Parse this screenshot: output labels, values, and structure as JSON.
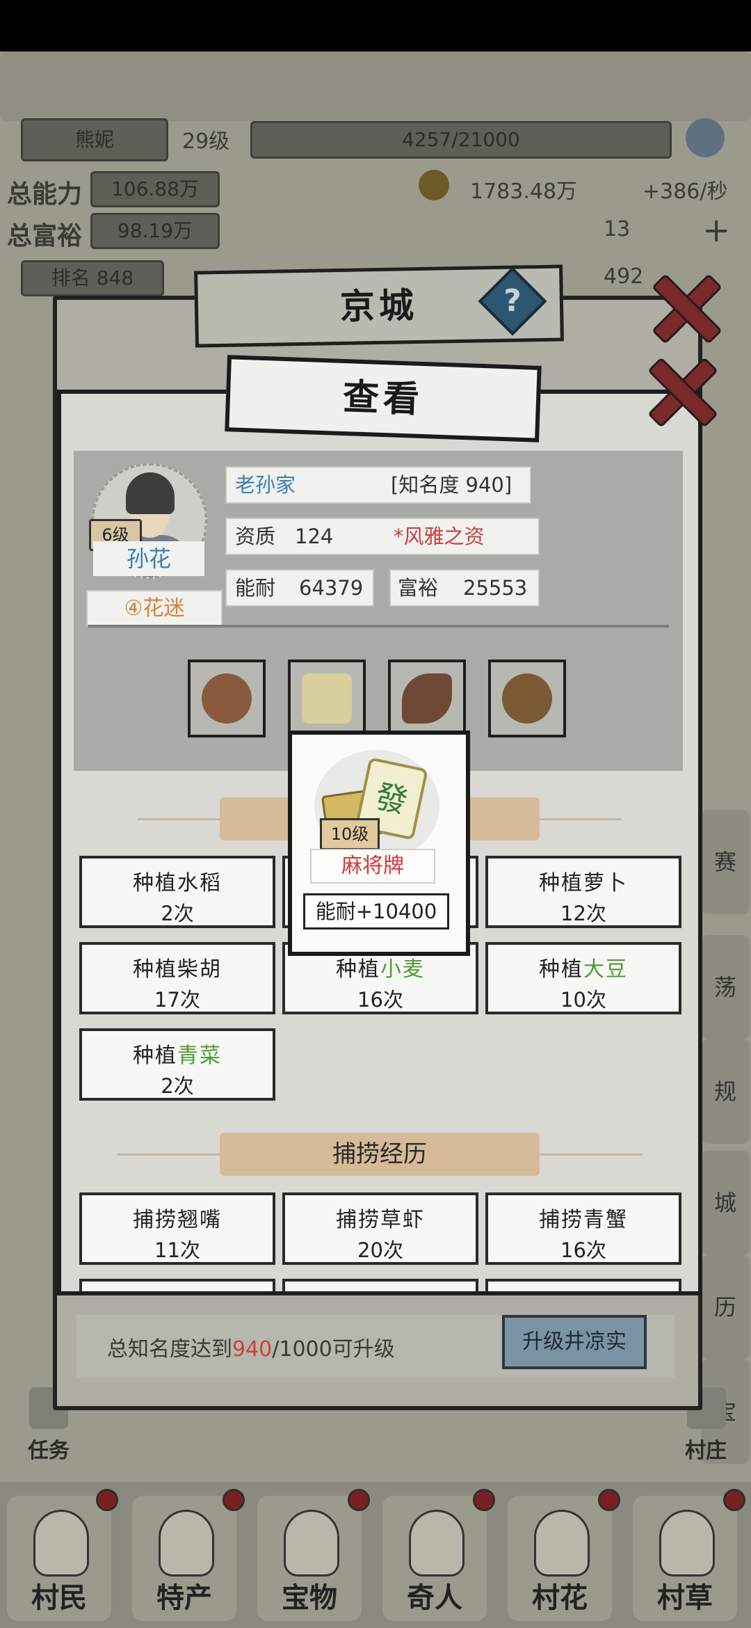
{
  "background": {
    "player_name": "熊妮",
    "player_level": "29级",
    "exp_progress": "4257/21000",
    "left_label_1": "总能力",
    "left_value_1": "106.88万",
    "left_label_2": "总富裕",
    "left_value_2": "98.19万",
    "coins": "1783.48万",
    "coin_rate": "+386/秒",
    "count": "13",
    "rank": "排名 848",
    "num_492": "492",
    "task_label": "任务",
    "village_label": "村庄",
    "side_tabs": [
      "赛",
      "荡",
      "规",
      "城",
      "历",
      "宝"
    ]
  },
  "back_panel": {
    "title": "京城",
    "help": "?",
    "footer_prefix": "总知名度达到",
    "footer_current": "940",
    "footer_suffix": "/1000可升级",
    "upgrade_button": "升级井凉实"
  },
  "bottom_nav": [
    "村民",
    "特产",
    "宝物",
    "奇人",
    "村花",
    "村草"
  ],
  "view_panel": {
    "title": "查看",
    "level": "6级",
    "name": "孙花",
    "hobby": "④花迷",
    "family": "老孙家",
    "fame": "[知名度 940]",
    "talent_label": "资质",
    "talent_value": "124",
    "talent_trait": "*风雅之资",
    "ability_label": "能耐",
    "ability_value": "64379",
    "wealth_label": "富裕",
    "wealth_value": "25553",
    "equipment": [
      "spinning-wheel-icon",
      "mahjong-tile-icon",
      "pipa-icon",
      "bowl-icon"
    ],
    "farming": [
      {
        "verb": "种植",
        "crop": "水稻",
        "crop_color": "#222222",
        "count": "2次"
      },
      {
        "verb": "种植",
        "crop": "",
        "crop_color": "#222222",
        "count": ""
      },
      {
        "verb": "种植",
        "crop": "萝卜",
        "crop_color": "#222222",
        "count": "12次"
      },
      {
        "verb": "种植",
        "crop": "柴胡",
        "crop_color": "#222222",
        "count": "17次"
      },
      {
        "verb": "种植",
        "crop": "小麦",
        "crop_color": "#4e9a35",
        "count": "16次"
      },
      {
        "verb": "种植",
        "crop": "大豆",
        "crop_color": "#4e9a35",
        "count": "10次"
      },
      {
        "verb": "种植",
        "crop": "青菜",
        "crop_color": "#4e9a35",
        "count": "2次"
      }
    ],
    "fishing_title": "捕捞经历",
    "fishing": [
      {
        "label": "捕捞翘嘴",
        "count": "11次"
      },
      {
        "label": "捕捞草虾",
        "count": "20次"
      },
      {
        "label": "捕捞青蟹",
        "count": "16次"
      }
    ]
  },
  "tooltip": {
    "level": "10级",
    "item_name": "麻将牌",
    "tile_char": "發",
    "effect": "能耐+10400"
  }
}
